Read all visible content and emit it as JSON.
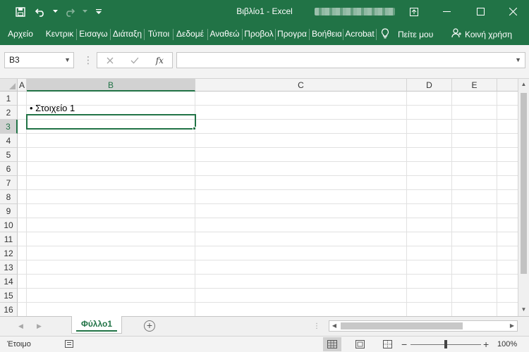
{
  "window": {
    "title": "Βιβλίο1  -  Excel",
    "colors": {
      "accent": "#217346",
      "grid": "#e1e1e1"
    }
  },
  "quick_access": {
    "icons": [
      "save-icon",
      "undo-icon",
      "redo-icon",
      "customize-qat-icon"
    ]
  },
  "window_controls": {
    "icons": [
      "ribbon-display-options-icon",
      "minimize-icon",
      "maximize-icon",
      "close-icon"
    ]
  },
  "ribbon": {
    "tabs": [
      {
        "label": "Αρχείο"
      },
      {
        "label": "Κεντρικ"
      },
      {
        "label": "Εισαγω"
      },
      {
        "label": "Διάταξη"
      },
      {
        "label": "Τύποι"
      },
      {
        "label": "Δεδομέ"
      },
      {
        "label": "Αναθεώ"
      },
      {
        "label": "Προβολ"
      },
      {
        "label": "Προγρα"
      },
      {
        "label": "Βοήθεια"
      },
      {
        "label": "Acrobat"
      }
    ],
    "tell_me": "Πείτε μου",
    "share": "Κοινή χρήση"
  },
  "formula_bar": {
    "name_box": "B3",
    "formula": "",
    "fx_label": "fx"
  },
  "sheet": {
    "columns": [
      "A",
      "B",
      "C",
      "D",
      "E"
    ],
    "selected_column": "B",
    "rows": [
      "1",
      "2",
      "3",
      "4",
      "5",
      "6",
      "7",
      "8",
      "9",
      "10",
      "11",
      "12",
      "13",
      "14",
      "15",
      "16"
    ],
    "selected_row": "3",
    "cells": {
      "B2": "• Στοιχείο 1"
    },
    "active_cell": "B3"
  },
  "sheet_tabs": {
    "tabs": [
      {
        "label": "Φύλλο1",
        "active": true
      }
    ]
  },
  "status_bar": {
    "status": "Έτοιμο",
    "zoom": "100%",
    "zoom_level": 100
  }
}
